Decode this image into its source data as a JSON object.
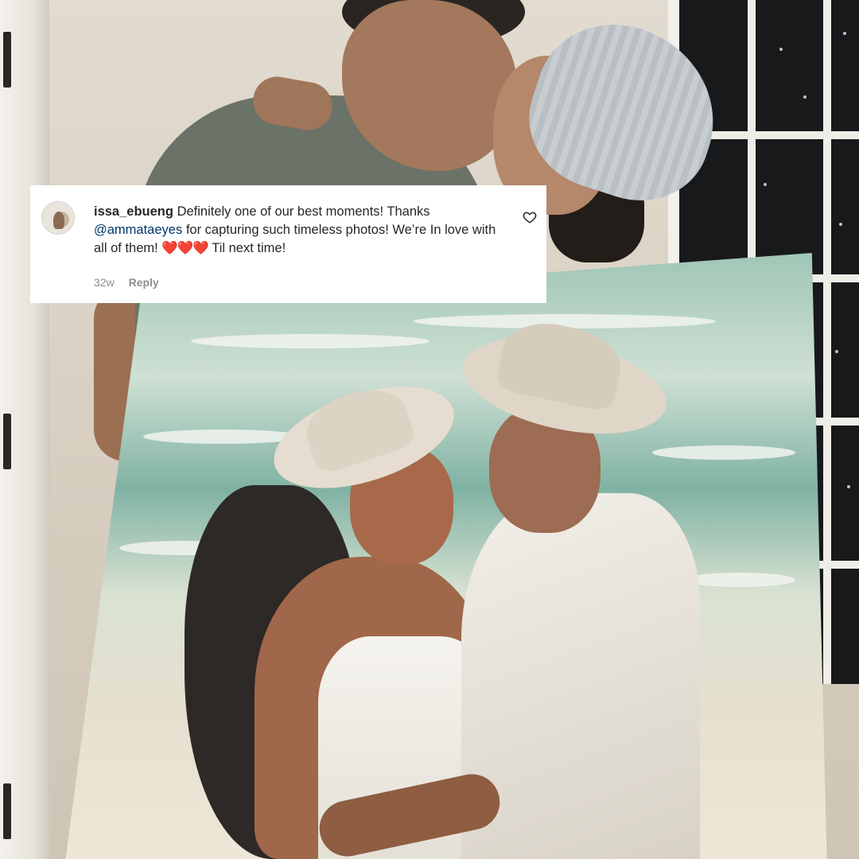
{
  "comment": {
    "username": "issa_ebueng",
    "text_before_mention": "Definitely one of our best moments! Thanks",
    "mention": "@ammataeyes",
    "text_after_mention": "for capturing such timeless photos! We’re In love with all of them!",
    "emojis": "❤️❤️❤️",
    "text_end": "Til next time!",
    "timestamp": "32w",
    "reply_label": "Reply",
    "like_icon": "heart-outline-icon",
    "avatar_icon": "user-avatar"
  },
  "colors": {
    "text": "#262626",
    "mention": "#00376b",
    "meta": "#8e8e8e",
    "card_background": "#ffffff"
  }
}
